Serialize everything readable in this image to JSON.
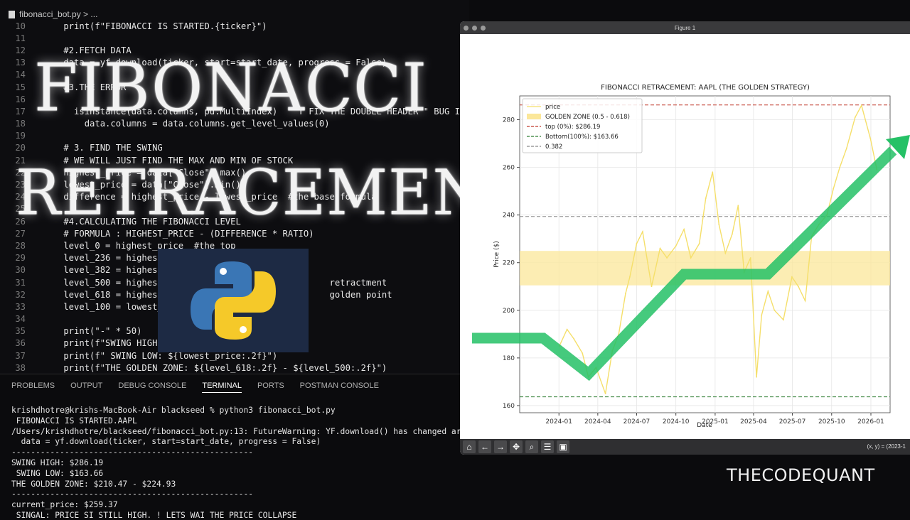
{
  "editor": {
    "breadcrumb": "fibonacci_bot.py > ...",
    "lines": [
      {
        "n": "10",
        "code": "    print(f\"FIBONACCI IS STARTED.{ticker}\")"
      },
      {
        "n": "11",
        "code": ""
      },
      {
        "n": "12",
        "code": "    #2.FETCH DATA"
      },
      {
        "n": "13",
        "code": "    data = yf.download(ticker, start=start_date, progress = False)"
      },
      {
        "n": "14",
        "code": ""
      },
      {
        "n": "15",
        "code": "    #3.THE ERROR"
      },
      {
        "n": "16",
        "code": ""
      },
      {
        "n": "17",
        "code": "      isinstance(data.columns, pd.MultiIndex)    T FIX THE DOUBLE HEADER \" BUG IN"
      },
      {
        "n": "18",
        "code": "        data.columns = data.columns.get_level_values(0)"
      },
      {
        "n": "19",
        "code": ""
      },
      {
        "n": "20",
        "code": "    # 3. FIND THE SWING"
      },
      {
        "n": "21",
        "code": "    # WE WILL JUST FIND THE MAX AND MIN OF STOCK"
      },
      {
        "n": "22",
        "code": "    highest_price = data[\"Close\"].max()"
      },
      {
        "n": "23",
        "code": "    lowest_price = data[\"Close\"].min()"
      },
      {
        "n": "24",
        "code": "    difference = highest_price - lowest_price  #the base formula"
      },
      {
        "n": "25",
        "code": ""
      },
      {
        "n": "26",
        "code": "    #4.CALCULATING THE FIBONACCI LEVEL"
      },
      {
        "n": "27",
        "code": "    # FORMULA : HIGHEST_PRICE - (DIFFERENCE * RATIO)"
      },
      {
        "n": "28",
        "code": "    level_0 = highest_price  #the top"
      },
      {
        "n": "29",
        "code": "    level_236 = highest_pric"
      },
      {
        "n": "30",
        "code": "    level_382 = highest_pric"
      },
      {
        "n": "31",
        "code": "    level_500 = highest_pric                           retractment"
      },
      {
        "n": "32",
        "code": "    level_618 = highest_pric                           golden point"
      },
      {
        "n": "33",
        "code": "    level_100 = lowest_pric"
      },
      {
        "n": "34",
        "code": ""
      },
      {
        "n": "35",
        "code": "    print(\"-\" * 50)"
      },
      {
        "n": "36",
        "code": "    print(f\"SWING HIGH: ${h"
      },
      {
        "n": "37",
        "code": "    print(f\" SWING LOW: ${lowest_price:.2f}\")"
      },
      {
        "n": "38",
        "code": "    print(f\"THE GOLDEN ZONE: ${level_618:.2f} - ${level_500:.2f}\")"
      }
    ]
  },
  "overlay": {
    "title_line1": "FIBONACCI",
    "title_line2": "RETRACEMENT",
    "brand": "THECODEQUANT"
  },
  "panel": {
    "tabs": [
      "PROBLEMS",
      "OUTPUT",
      "DEBUG CONSOLE",
      "TERMINAL",
      "PORTS",
      "POSTMAN CONSOLE"
    ],
    "active_tab": "TERMINAL",
    "terminal_lines": [
      "krishdhotre@krishs-MacBook-Air blackseed % python3 fibonacci_bot.py",
      " FIBONACCI IS STARTED.AAPL",
      "/Users/krishdhotre/blackseed/fibonacci_bot.py:13: FutureWarning: YF.download() has changed argu",
      "  data = yf.download(ticker, start=start_date, progress = False)",
      "--------------------------------------------------",
      "SWING HIGH: $286.19",
      " SWING LOW: $163.66",
      "THE GOLDEN ZONE: $210.47 - $224.93",
      "--------------------------------------------------",
      "current_price: $259.37",
      " SINGAL: PRICE SI STILL HIGH. ! LETS WAI THE PRICE COLLAPSE"
    ]
  },
  "figure": {
    "window_title": "Figure 1",
    "coords_text": "(x, y) = (2023-1",
    "toolbar_icons": [
      "home-icon",
      "back-arrow-icon",
      "forward-arrow-icon",
      "pan-icon",
      "zoom-icon",
      "configure-icon",
      "save-icon"
    ],
    "toolbar_glyphs": [
      "⌂",
      "←",
      "→",
      "✥",
      "⌕",
      "☰",
      "▣"
    ]
  },
  "chart_data": {
    "type": "line",
    "title": "FIBONACCI RETRACEMENT: AAPL (THE GOLDEN STRATEGY)",
    "xlabel": "Date",
    "ylabel": "Price ($)",
    "ylim": [
      157,
      290
    ],
    "xlim": [
      "2023-10-01",
      "2026-02-15"
    ],
    "x_ticks": [
      "2024-01",
      "2024-04",
      "2024-07",
      "2024-10",
      "2025-01",
      "2025-04",
      "2025-07",
      "2025-10",
      "2026-01"
    ],
    "y_ticks": [
      160,
      180,
      200,
      220,
      240,
      260,
      280
    ],
    "grid": true,
    "legend_position": "upper-left",
    "colors": {
      "price": "#f5df6a",
      "zone": "#fbe79a",
      "top": "#c0392b",
      "bottom": "#2e7d32",
      "level382": "#888888",
      "arrow": "#25c166"
    },
    "series": [
      {
        "name": "price",
        "x": [
          "2024-01-02",
          "2024-01-20",
          "2024-02-05",
          "2024-02-25",
          "2024-03-10",
          "2024-03-28",
          "2024-04-19",
          "2024-05-05",
          "2024-05-20",
          "2024-06-05",
          "2024-06-15",
          "2024-07-01",
          "2024-07-15",
          "2024-08-05",
          "2024-08-25",
          "2024-09-10",
          "2024-10-01",
          "2024-10-20",
          "2024-11-05",
          "2024-11-25",
          "2024-12-10",
          "2024-12-26",
          "2025-01-10",
          "2025-01-25",
          "2025-02-10",
          "2025-02-24",
          "2025-03-10",
          "2025-03-25",
          "2025-04-08",
          "2025-04-20",
          "2025-05-05",
          "2025-05-20",
          "2025-06-10",
          "2025-06-30",
          "2025-07-15",
          "2025-07-31",
          "2025-08-15",
          "2025-09-01",
          "2025-09-20",
          "2025-10-05",
          "2025-10-20",
          "2025-11-05",
          "2025-11-25",
          "2025-12-10",
          "2025-12-31",
          "2026-01-15"
        ],
        "values": [
          185,
          192,
          188,
          182,
          172,
          176,
          165,
          183,
          190,
          207,
          214,
          228,
          233,
          210,
          226,
          222,
          227,
          234,
          222,
          228,
          247,
          258,
          236,
          224,
          232,
          244,
          216,
          222,
          172,
          198,
          208,
          200,
          196,
          214,
          210,
          204,
          231,
          236,
          240,
          251,
          260,
          268,
          281,
          286,
          272,
          259
        ]
      }
    ],
    "hlines": [
      {
        "name": "top (0%): $286.19",
        "y": 286.19
      },
      {
        "name": "0.382",
        "y": 239.39
      },
      {
        "name": "Bottom(100%): $163.66",
        "y": 163.66
      }
    ],
    "bands": [
      {
        "name": "GOLDEN ZONE (0.5 - 0.618)",
        "y0": 210.47,
        "y1": 224.93
      }
    ],
    "legend": [
      "price",
      "GOLDEN ZONE (0.5 - 0.618)",
      "top (0%): $286.19",
      "Bottom(100%): $163.66",
      "0.382"
    ]
  }
}
